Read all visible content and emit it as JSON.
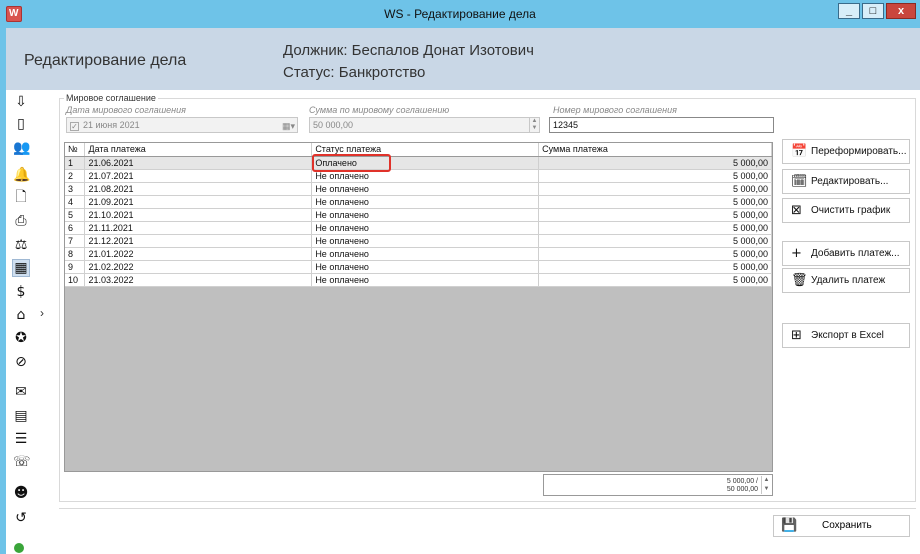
{
  "window": {
    "title": "WS - Редактирование дела",
    "buttons": {
      "minimize": "_",
      "maximize": "□",
      "close": "x"
    }
  },
  "header": {
    "screen_title": "Редактирование дела",
    "debtor": "Должник: Беспалов Донат Изотович",
    "status": "Статус: Банкротство"
  },
  "settlement": {
    "group_title": "Мировое соглашение",
    "date_label": "Дата мирового соглашения",
    "date_value": "21   июня   2021",
    "sum_label": "Сумма по мировому соглашению",
    "sum_value": "50 000,00",
    "number_label": "Номер мирового соглашения",
    "number_value": "12345"
  },
  "table": {
    "columns": [
      "№",
      "Дата платежа",
      "Статус платежа",
      "Сумма платежа"
    ],
    "rows": [
      {
        "n": "1",
        "date": "21.06.2021",
        "status": "Оплачено",
        "amount": "5 000,00"
      },
      {
        "n": "2",
        "date": "21.07.2021",
        "status": "Не оплачено",
        "amount": "5 000,00"
      },
      {
        "n": "3",
        "date": "21.08.2021",
        "status": "Не оплачено",
        "amount": "5 000,00"
      },
      {
        "n": "4",
        "date": "21.09.2021",
        "status": "Не оплачено",
        "amount": "5 000,00"
      },
      {
        "n": "5",
        "date": "21.10.2021",
        "status": "Не оплачено",
        "amount": "5 000,00"
      },
      {
        "n": "6",
        "date": "21.11.2021",
        "status": "Не оплачено",
        "amount": "5 000,00"
      },
      {
        "n": "7",
        "date": "21.12.2021",
        "status": "Не оплачено",
        "amount": "5 000,00"
      },
      {
        "n": "8",
        "date": "21.01.2022",
        "status": "Не оплачено",
        "amount": "5 000,00"
      },
      {
        "n": "9",
        "date": "21.02.2022",
        "status": "Не оплачено",
        "amount": "5 000,00"
      },
      {
        "n": "10",
        "date": "21.03.2022",
        "status": "Не оплачено",
        "amount": "5 000,00"
      }
    ],
    "total_paid": "5 000,00 /",
    "total_sum": "50 000,00"
  },
  "actions": {
    "reformat": "Переформировать...",
    "edit": "Редактировать...",
    "clear": "Очистить график",
    "add": "Добавить платеж...",
    "delete": "Удалить платеж",
    "export": "Экспорт в Excel",
    "save": "Сохранить"
  },
  "sidebar_icons": [
    "import-doc-icon",
    "document-icon",
    "users-icon",
    "bell-icon",
    "document-search-icon",
    "print-icon",
    "court-icon",
    "calendar-icon",
    "dollar-icon",
    "house-search-icon",
    "seal-icon",
    "cancel-icon",
    "mail-icon",
    "file-icon",
    "file-text-icon",
    "chat-icon",
    "people-speak-icon",
    "history-icon"
  ],
  "colors": {
    "titlebar": "#6ec3e8",
    "header": "#c9d7e6",
    "highlight": "#e0322a",
    "selected_row": "#e6e6e6"
  }
}
